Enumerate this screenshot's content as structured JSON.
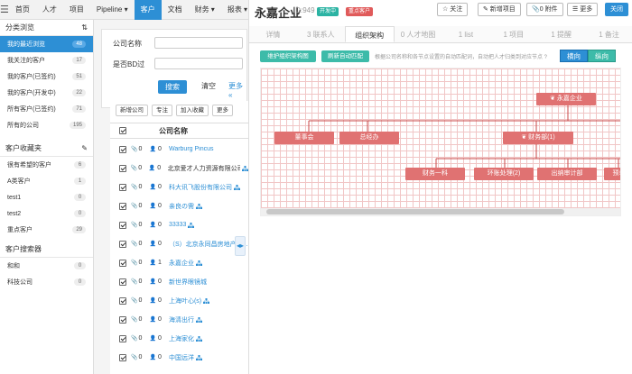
{
  "nav": {
    "items": [
      "首页",
      "人才",
      "项目",
      "Pipeline ▾",
      "客户",
      "文档",
      "财务 ▾",
      "报表 ▾",
      "Ca"
    ],
    "active_index": 4
  },
  "sidebar": {
    "browse_title": "分类浏览",
    "browse_items": [
      {
        "label": "我的最近浏览",
        "count": "48",
        "active": true
      },
      {
        "label": "我关注的客户",
        "count": "17"
      },
      {
        "label": "我的客户(已签约)",
        "count": "51"
      },
      {
        "label": "我的客户(开发中)",
        "count": "22"
      },
      {
        "label": "所有客户(已签约)",
        "count": "71"
      },
      {
        "label": "所有的公司",
        "count": "195"
      }
    ],
    "fav_title": "客户收藏夹",
    "fav_items": [
      {
        "label": "很有希望的客户",
        "count": "6"
      },
      {
        "label": "A类客户",
        "count": "1"
      },
      {
        "label": "test1",
        "count": "0"
      },
      {
        "label": "test2",
        "count": "0"
      },
      {
        "label": "重点客户",
        "count": "29"
      }
    ],
    "searcher_title": "客户搜索器",
    "searcher_items": [
      {
        "label": "和和",
        "count": "0"
      },
      {
        "label": "科技公司",
        "count": "0"
      }
    ]
  },
  "filter": {
    "company_label": "公司名称",
    "bd_label": "是否BD过",
    "search_btn": "搜索",
    "clear_btn": "清空",
    "more_btn": "更多 «"
  },
  "list": {
    "toolbar": [
      "新增公司",
      "专注",
      "加入收藏",
      "更多"
    ],
    "header": "公司名称",
    "rows": [
      {
        "a": "0",
        "b": "0",
        "name": "Warburg Pincus",
        "link": true,
        "org": false
      },
      {
        "a": "0",
        "b": "0",
        "name": "北京爱才人力资源有限公司",
        "link": false,
        "org": true
      },
      {
        "a": "0",
        "b": "0",
        "name": "科大讯飞股份有限公司",
        "link": true,
        "org": true
      },
      {
        "a": "0",
        "b": "0",
        "name": "亲良の需",
        "link": true,
        "org": true
      },
      {
        "a": "0",
        "b": "0",
        "name": "33333",
        "link": true,
        "org": true
      },
      {
        "a": "0",
        "b": "0",
        "name": "（S）北京永同昌房地产开...",
        "link": true,
        "org": false
      },
      {
        "a": "0",
        "b": "1",
        "name": "永嘉企业",
        "link": true,
        "org": true
      },
      {
        "a": "0",
        "b": "0",
        "name": "新世界眼镜城",
        "link": true,
        "org": false
      },
      {
        "a": "0",
        "b": "0",
        "name": "上海叶心(s)",
        "link": true,
        "org": true
      },
      {
        "a": "0",
        "b": "0",
        "name": "海清出行",
        "link": true,
        "org": true
      },
      {
        "a": "0",
        "b": "0",
        "name": "上海家化",
        "link": true,
        "org": true
      },
      {
        "a": "0",
        "b": "0",
        "name": "中国远洋",
        "link": true,
        "org": true
      }
    ]
  },
  "detail": {
    "title": "永嘉企业",
    "id": "ID:949",
    "tags": [
      "开发中",
      "重点客户"
    ],
    "buttons": [
      "☆ 关注",
      "✎ 新增项目",
      "📎0 附件",
      "☰ 更多",
      "关闭"
    ],
    "tabs": [
      "详情",
      "3 联系人",
      "组织架构",
      "0 人才地图",
      "1 list",
      "1 项目",
      "1 提醒",
      "1 备注"
    ],
    "active_tab": 2,
    "btn_maintain": "维护组织架构图",
    "btn_refresh": "刷新自动匹配",
    "hint": "根据公司名称和各节点设置的自动匹配词，自动把人才归类到对应节点 ?",
    "orient_h": "横向",
    "orient_v": "纵向"
  },
  "org": {
    "root": "永嘉企业",
    "level1": [
      "董事会",
      "总经办",
      "财务部(1)"
    ],
    "level2": [
      "财务一科",
      "环账处理(2)",
      "出纳审计部",
      "预单网"
    ]
  },
  "colors": {
    "accent": "#2d8fd5",
    "teal": "#3dbba9",
    "node": "#e07272",
    "red_tag": "#e05a5a"
  }
}
